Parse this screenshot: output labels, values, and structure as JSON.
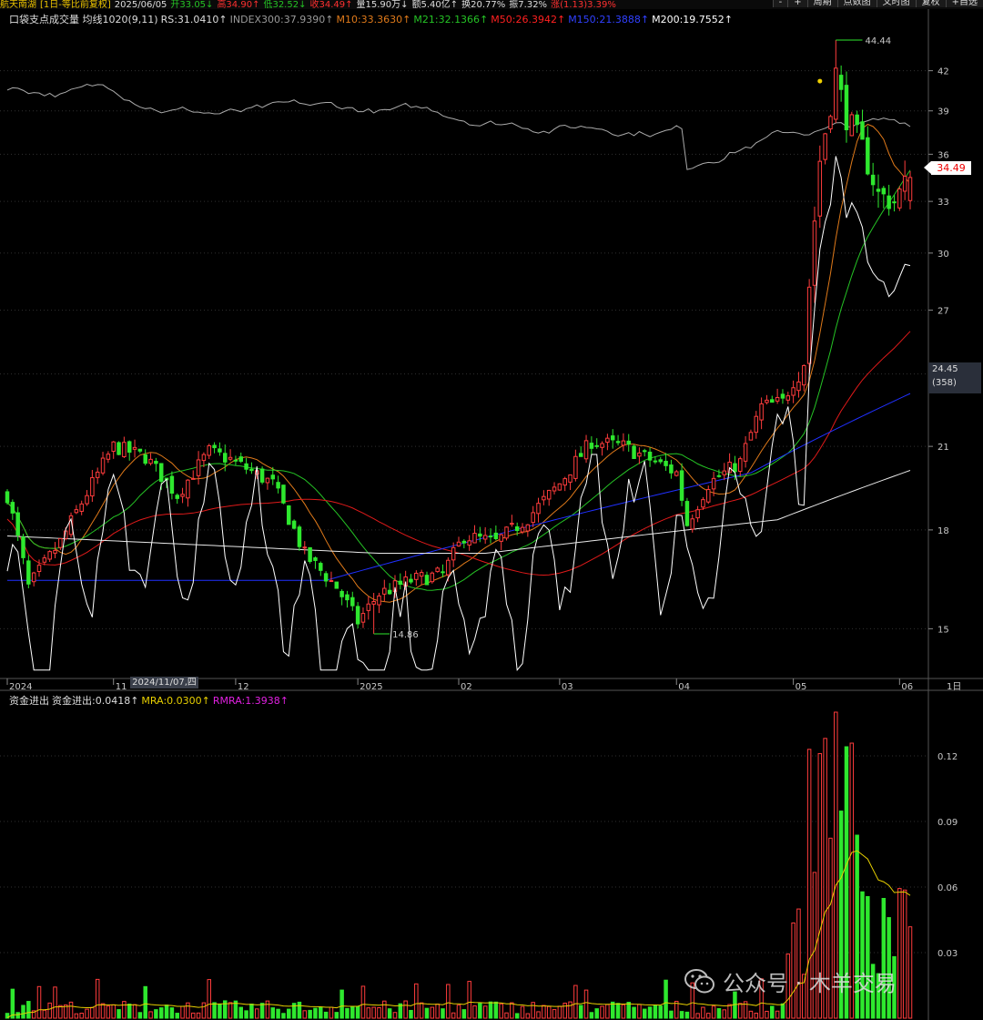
{
  "topbar": {
    "items": [
      {
        "text": "航天南湖",
        "color": "#e8c000"
      },
      {
        "text": "[1日-等比前复权]",
        "color": "#e8c000"
      },
      {
        "text": "2025/06/05",
        "color": "#dddddd"
      },
      {
        "text": "开33.05↓",
        "color": "#25c325"
      },
      {
        "text": "高34.90↑",
        "color": "#ff3030"
      },
      {
        "text": "低32.52↓",
        "color": "#25c325"
      },
      {
        "text": "收34.49↑",
        "color": "#ff3030"
      },
      {
        "text": "量15.90万↓",
        "color": "#dddddd"
      },
      {
        "text": "额5.40亿↑",
        "color": "#dddddd"
      },
      {
        "text": "换20.77%",
        "color": "#dddddd"
      },
      {
        "text": "振7.32%",
        "color": "#dddddd"
      },
      {
        "text": "涨(1.13)3.39%",
        "color": "#ff3030"
      }
    ],
    "buttons": [
      "-",
      "+",
      "周期",
      "点数图",
      "叉时图",
      "复权",
      "+自选"
    ]
  },
  "main_legend": [
    {
      "text": "口袋支点成交量 均线1020(9,11)",
      "color": "#dddddd"
    },
    {
      "text": "RS:31.0410↑",
      "color": "#dddddd"
    },
    {
      "text": "INDEX300:37.9390↑",
      "color": "#999999"
    },
    {
      "text": "M10:33.3630↑",
      "color": "#e07a1a"
    },
    {
      "text": "M21:32.1366↑",
      "color": "#25c325"
    },
    {
      "text": "M50:26.3942↑",
      "color": "#ff2020"
    },
    {
      "text": "M150:21.3888↑",
      "color": "#3040ff"
    },
    {
      "text": "M200:19.7552↑",
      "color": "#ffffff"
    }
  ],
  "sub_legend": [
    {
      "text": "资金进出",
      "color": "#dddddd"
    },
    {
      "text": "资金进出:0.0418↑",
      "color": "#dddddd"
    },
    {
      "text": "MRA:0.0300↑",
      "color": "#e8d000"
    },
    {
      "text": "RMRA:1.3938↑",
      "color": "#e020e0"
    }
  ],
  "price_tag": "34.49",
  "cursor_box": {
    "value": "24.45",
    "count": "(358)"
  },
  "date_box": "2024/11/07,四",
  "watermark": "公众号 · 木羊交易",
  "colors": {
    "up": "#ff3c3c",
    "down": "#2ee82e",
    "bg": "#000000",
    "grid": "#303030"
  },
  "chart_data": [
    {
      "type": "candlestick",
      "yscale": "log",
      "ylim": [
        13.8,
        45.5
      ],
      "yticks": [
        15,
        18,
        21,
        24,
        27,
        30,
        33,
        36,
        39,
        42
      ],
      "xticks": [
        {
          "label": "2024",
          "i": 0
        },
        {
          "label": "11",
          "i": 20
        },
        {
          "label": "12",
          "i": 43
        },
        {
          "label": "2025",
          "i": 66
        },
        {
          "label": "02",
          "i": 85
        },
        {
          "label": "03",
          "i": 104
        },
        {
          "label": "04",
          "i": 126
        },
        {
          "label": "05",
          "i": 148
        },
        {
          "label": "06",
          "i": 168
        }
      ],
      "period_label": "1日",
      "n_bars": 171,
      "annotations": [
        {
          "text": "44.44",
          "kind": "high"
        },
        {
          "text": "14.86",
          "kind": "low"
        }
      ],
      "series_keys": [
        "INDEX300",
        "M10",
        "M21",
        "M50",
        "M150",
        "M200",
        "RS"
      ]
    },
    {
      "type": "bar",
      "name": "资金进出",
      "ylim": [
        0,
        0.145
      ],
      "yticks": [
        0.03,
        0.06,
        0.09,
        0.12
      ],
      "lines": [
        "MRA"
      ]
    }
  ]
}
